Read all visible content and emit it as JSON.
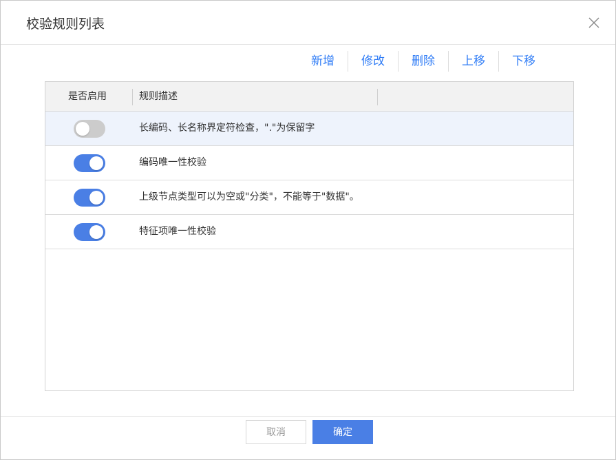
{
  "dialog": {
    "title": "校验规则列表",
    "close_icon": "close-icon"
  },
  "toolbar": {
    "add_label": "新增",
    "edit_label": "修改",
    "delete_label": "删除",
    "move_up_label": "上移",
    "move_down_label": "下移"
  },
  "grid": {
    "columns": [
      "是否启用",
      "规则描述"
    ],
    "rows": [
      {
        "enabled": false,
        "description": "长编码、长名称界定符检查，\".\"为保留字",
        "selected": true
      },
      {
        "enabled": true,
        "description": "编码唯一性校验",
        "selected": false
      },
      {
        "enabled": true,
        "description": "上级节点类型可以为空或\"分类\"，不能等于\"数据\"。",
        "selected": false
      },
      {
        "enabled": true,
        "description": "特征项唯一性校验",
        "selected": false
      }
    ]
  },
  "footer": {
    "cancel_label": "取消",
    "confirm_label": "确定"
  },
  "colors": {
    "accent": "#4a7fe5",
    "link": "#2f7cf6",
    "toggle_off": "#cccccc",
    "selected_row": "#eef3fc"
  }
}
